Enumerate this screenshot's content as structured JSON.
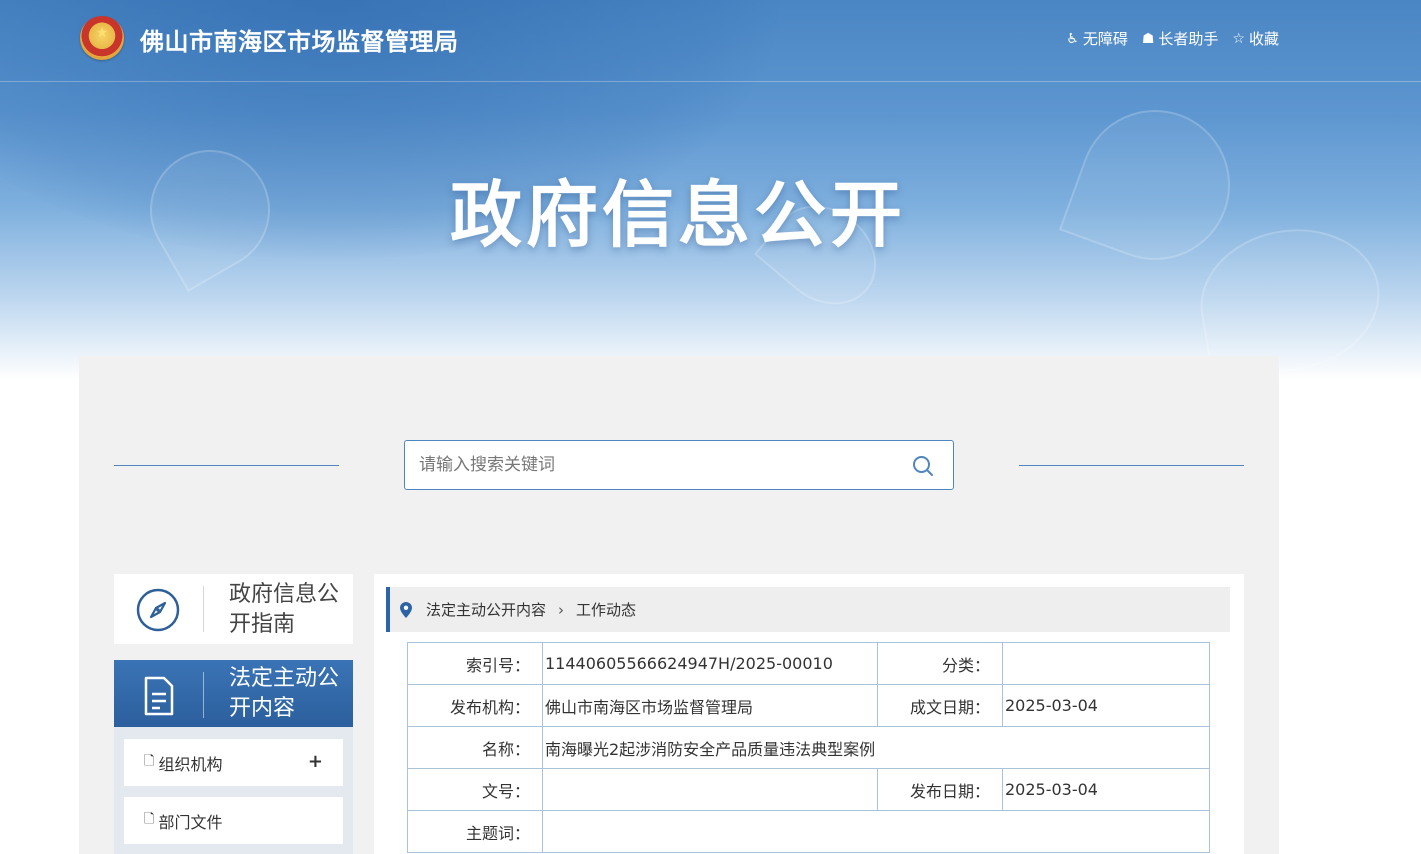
{
  "header": {
    "site_title": "佛山市南海区市场监督管理局",
    "links": [
      {
        "label": "无障碍",
        "icon": "wheelchair-icon"
      },
      {
        "label": "长者助手",
        "icon": "elder-helper-icon"
      },
      {
        "label": "收藏",
        "icon": "star-icon"
      }
    ]
  },
  "banner": {
    "title": "政府信息公开"
  },
  "search": {
    "placeholder": "请输入搜索关键词"
  },
  "sidebar": {
    "guide_label": "政府信息公开指南",
    "active_label": "法定主动公开内容",
    "items": [
      {
        "label": "组织机构",
        "expand": "+"
      },
      {
        "label": "部门文件"
      }
    ]
  },
  "breadcrumb": {
    "level1": "法定主动公开内容",
    "level2": "工作动态"
  },
  "meta": {
    "index_label": "索引号：",
    "index_value": "11440605566624947H/2025-00010",
    "category_label": "分类：",
    "category_value": "",
    "publisher_label": "发布机构：",
    "publisher_value": "佛山市南海区市场监督管理局",
    "created_label": "成文日期：",
    "created_value": "2025-03-04",
    "name_label": "名称：",
    "name_value": "南海曝光2起涉消防安全产品质量违法典型案例",
    "docno_label": "文号：",
    "docno_value": "",
    "published_label": "发布日期：",
    "published_value": "2025-03-04",
    "keywords_label": "主题词：",
    "keywords_value": ""
  },
  "colors": {
    "accent": "#2d64a6",
    "panel_bg": "#f1f1f1",
    "table_border": "#a9c3db"
  }
}
